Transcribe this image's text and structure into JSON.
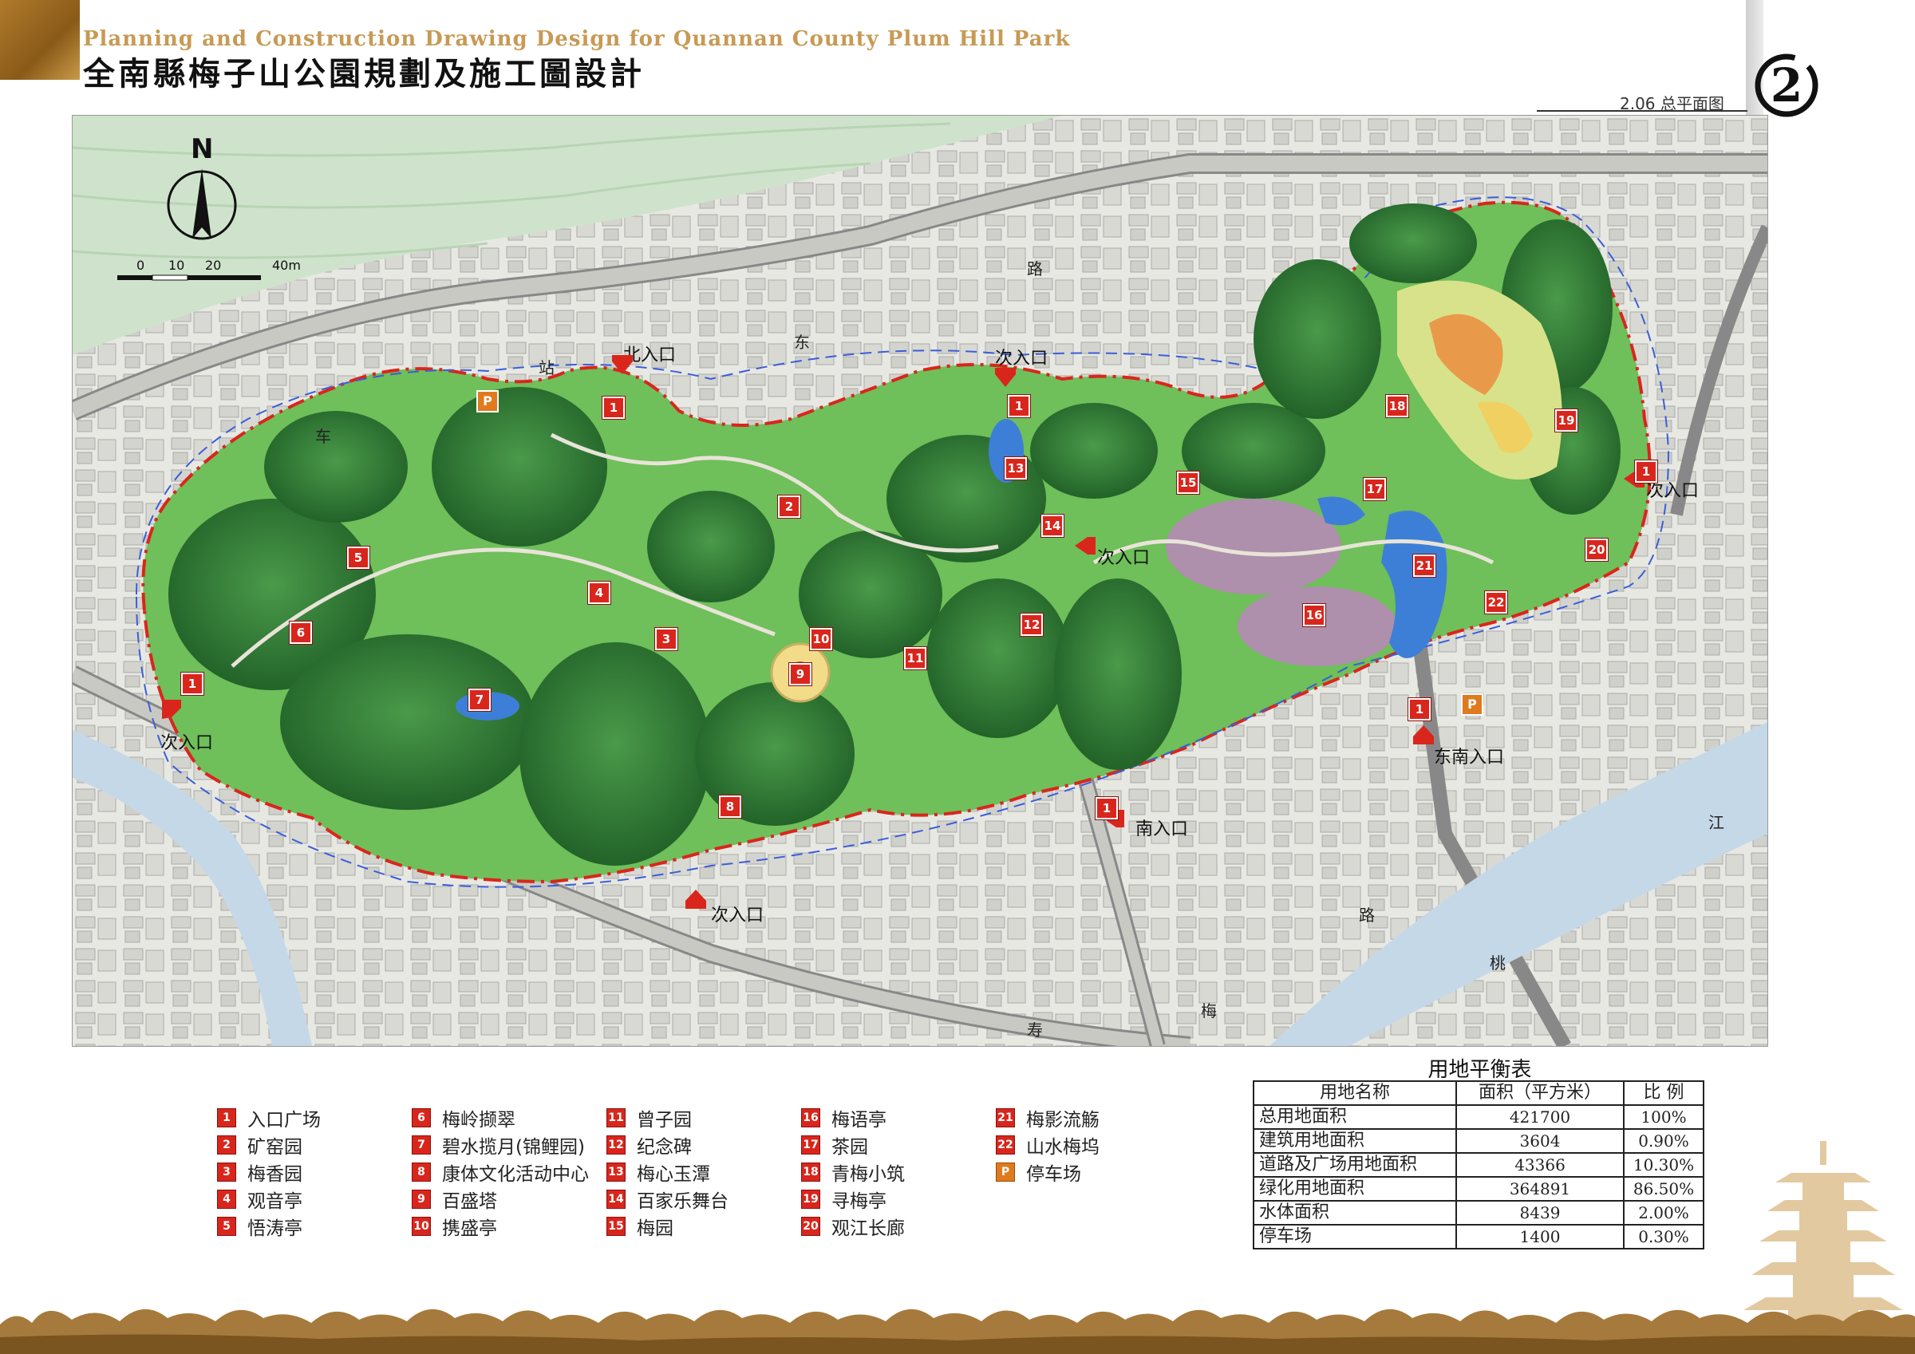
{
  "header": {
    "title_en": "Planning and Construction Drawing Design for Quannan County Plum Hill Park",
    "title_cn": "全南縣梅子山公園規劃及施工圖設計",
    "page_label": "2.06 总平面图",
    "page_number": "2"
  },
  "map": {
    "north_label": "N",
    "scale_ticks": [
      "0",
      "10",
      "20",
      "40m"
    ],
    "entrances": [
      {
        "label": "北入口"
      },
      {
        "label": "次入口"
      },
      {
        "label": "次入口"
      },
      {
        "label": "次入口"
      },
      {
        "label": "次入口"
      },
      {
        "label": "次入口"
      },
      {
        "label": "南入口"
      },
      {
        "label": "东南入口"
      }
    ],
    "road_names": [
      "站",
      "车",
      "东",
      "路",
      "路",
      "梅",
      "寿",
      "桃",
      "江"
    ],
    "markers": [
      "1",
      "1",
      "1",
      "1",
      "1",
      "1",
      "2",
      "3",
      "4",
      "5",
      "6",
      "7",
      "8",
      "9",
      "10",
      "11",
      "12",
      "13",
      "14",
      "15",
      "16",
      "17",
      "18",
      "19",
      "20",
      "21",
      "22"
    ],
    "parking_marker": "P"
  },
  "legend": {
    "items": [
      {
        "num": "1",
        "label": "入口广场"
      },
      {
        "num": "2",
        "label": "矿窑园"
      },
      {
        "num": "3",
        "label": "梅香园"
      },
      {
        "num": "4",
        "label": "观音亭"
      },
      {
        "num": "5",
        "label": "悟涛亭"
      },
      {
        "num": "6",
        "label": "梅岭撷翠"
      },
      {
        "num": "7",
        "label": "碧水揽月(锦鲤园)"
      },
      {
        "num": "8",
        "label": "康体文化活动中心"
      },
      {
        "num": "9",
        "label": "百盛塔"
      },
      {
        "num": "10",
        "label": "携盛亭"
      },
      {
        "num": "11",
        "label": "曾子园"
      },
      {
        "num": "12",
        "label": "纪念碑"
      },
      {
        "num": "13",
        "label": "梅心玉潭"
      },
      {
        "num": "14",
        "label": "百家乐舞台"
      },
      {
        "num": "15",
        "label": "梅园"
      },
      {
        "num": "16",
        "label": "梅语亭"
      },
      {
        "num": "17",
        "label": "茶园"
      },
      {
        "num": "18",
        "label": "青梅小筑"
      },
      {
        "num": "19",
        "label": "寻梅亭"
      },
      {
        "num": "20",
        "label": "观江长廊"
      },
      {
        "num": "21",
        "label": "梅影流觞"
      },
      {
        "num": "22",
        "label": "山水梅坞"
      },
      {
        "num": "P",
        "label": "停车场"
      }
    ]
  },
  "balance_table": {
    "title": "用地平衡表",
    "headers": [
      "用地名称",
      "面积（平方米）",
      "比 例"
    ],
    "rows": [
      [
        "总用地面积",
        "421700",
        "100%"
      ],
      [
        "建筑用地面积",
        "3604",
        "0.90%"
      ],
      [
        "道路及广场用地面积",
        "43366",
        "10.30%"
      ],
      [
        "绿化用地面积",
        "364891",
        "86.50%"
      ],
      [
        "水体面积",
        "8439",
        "2.00%"
      ],
      [
        "停车场",
        "1400",
        "0.30%"
      ]
    ]
  },
  "colors": {
    "park_green": "#6fbf5a",
    "forest_green": "#2e7a35",
    "boundary_red": "#d9261c",
    "marker_red": "#d9261c",
    "parking_orange": "#e07a1e",
    "water_blue": "#3d7fd6",
    "river_blue": "#c5d8e8",
    "brand_gold": "#c79a55",
    "plum_pink": "#b58ab5"
  }
}
